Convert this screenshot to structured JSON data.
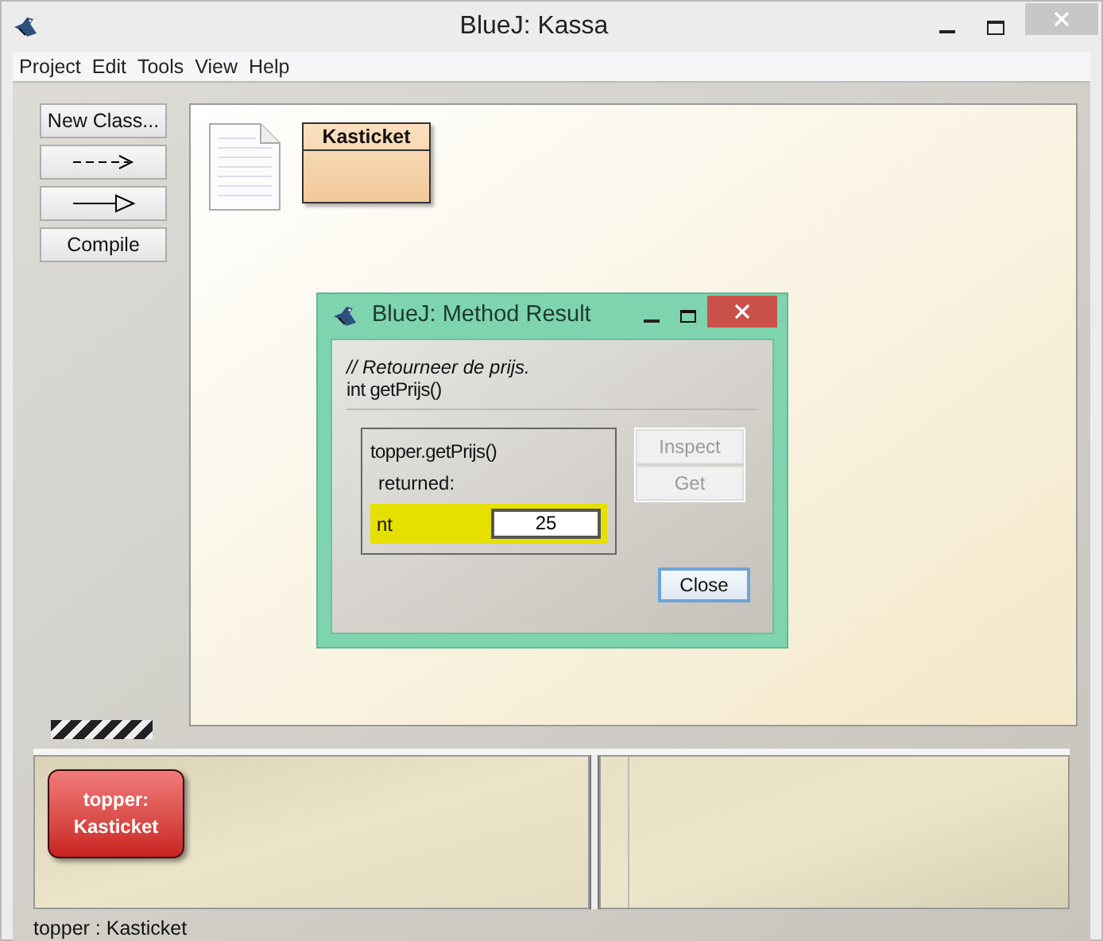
{
  "window": {
    "title": "BlueJ:  Kassa"
  },
  "menu": [
    "Project",
    "Edit",
    "Tools",
    "View",
    "Help"
  ],
  "tools": [
    {
      "kind": "text",
      "label": "New Class..."
    },
    {
      "kind": "dashed-arrow"
    },
    {
      "kind": "solid-arrow"
    },
    {
      "kind": "text",
      "label": "Compile"
    }
  ],
  "classes": [
    {
      "name": "Kasticket"
    }
  ],
  "dialog": {
    "title": "BlueJ:  Method Result",
    "comment": "// Retourneer de prijs.",
    "signature": "int getPrijs()",
    "call": "topper.getPrijs()",
    "returned_label": "returned:",
    "result_type": "nt",
    "result_value": "25",
    "buttons": [
      {
        "label": "Inspect",
        "disabled": true
      },
      {
        "label": "Get",
        "disabled": true
      }
    ],
    "close_button": "Close"
  },
  "object_bench": [
    {
      "name": "topper:",
      "class": "Kasticket"
    }
  ],
  "status_bar": "topper : Kasticket"
}
